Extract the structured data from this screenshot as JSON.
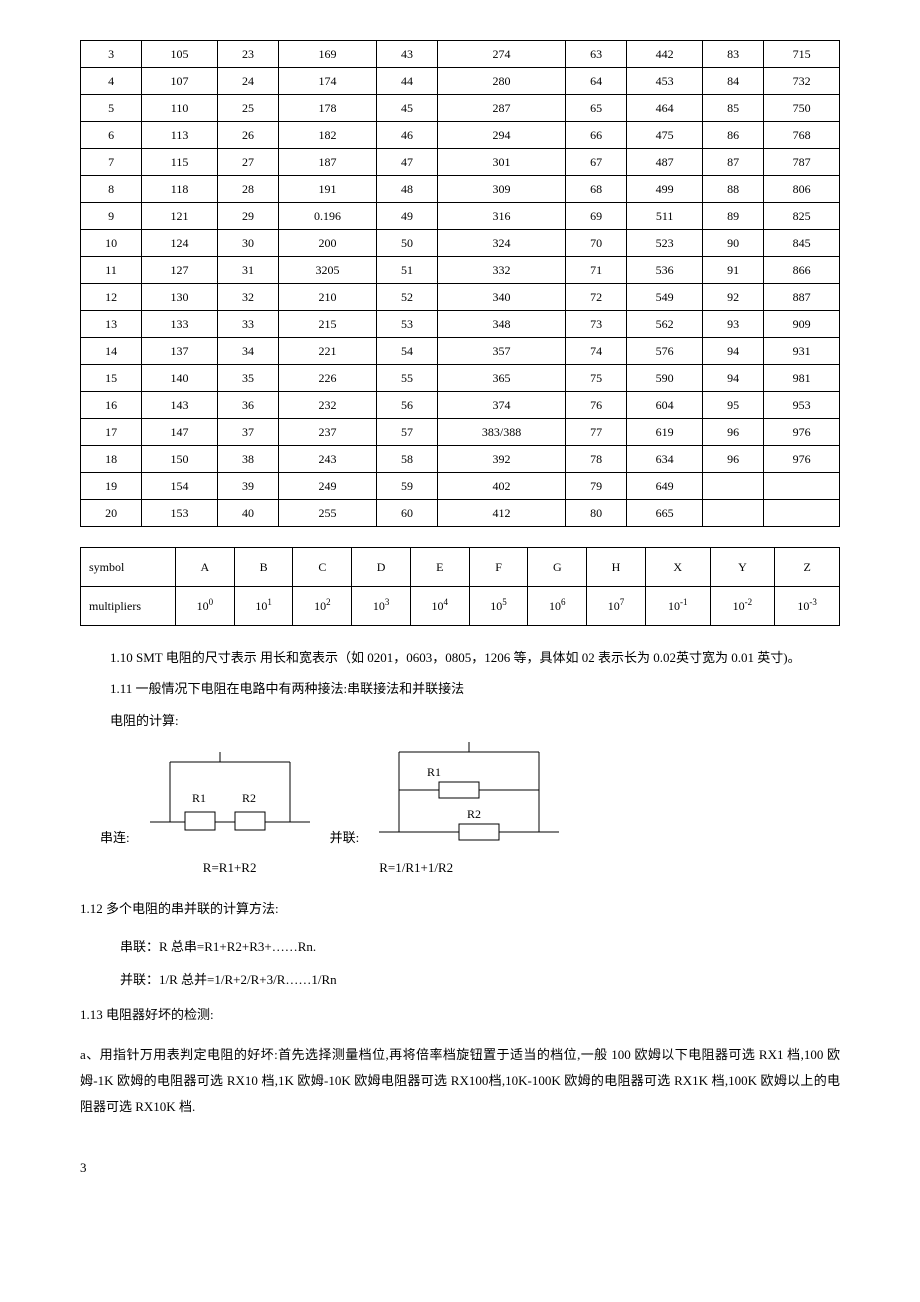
{
  "table1": {
    "rows": [
      [
        "3",
        "105",
        "23",
        "169",
        "43",
        "274",
        "63",
        "442",
        "83",
        "715"
      ],
      [
        "4",
        "107",
        "24",
        "174",
        "44",
        "280",
        "64",
        "453",
        "84",
        "732"
      ],
      [
        "5",
        "110",
        "25",
        "178",
        "45",
        "287",
        "65",
        "464",
        "85",
        "750"
      ],
      [
        "6",
        "113",
        "26",
        "182",
        "46",
        "294",
        "66",
        "475",
        "86",
        "768"
      ],
      [
        "7",
        "115",
        "27",
        "187",
        "47",
        "301",
        "67",
        "487",
        "87",
        "787"
      ],
      [
        "8",
        "118",
        "28",
        "191",
        "48",
        "309",
        "68",
        "499",
        "88",
        "806"
      ],
      [
        "9",
        "121",
        "29",
        "0.196",
        "49",
        "316",
        "69",
        "511",
        "89",
        "825"
      ],
      [
        "10",
        "124",
        "30",
        "200",
        "50",
        "324",
        "70",
        "523",
        "90",
        "845"
      ],
      [
        "11",
        "127",
        "31",
        "3205",
        "51",
        "332",
        "71",
        "536",
        "91",
        "866"
      ],
      [
        "12",
        "130",
        "32",
        "210",
        "52",
        "340",
        "72",
        "549",
        "92",
        "887"
      ],
      [
        "13",
        "133",
        "33",
        "215",
        "53",
        "348",
        "73",
        "562",
        "93",
        "909"
      ],
      [
        "14",
        "137",
        "34",
        "221",
        "54",
        "357",
        "74",
        "576",
        "94",
        "931"
      ],
      [
        "15",
        "140",
        "35",
        "226",
        "55",
        "365",
        "75",
        "590",
        "94",
        "981"
      ],
      [
        "16",
        "143",
        "36",
        "232",
        "56",
        "374",
        "76",
        "604",
        "95",
        "953"
      ],
      [
        "17",
        "147",
        "37",
        "237",
        "57",
        "383/388",
        "77",
        "619",
        "96",
        "976"
      ],
      [
        "18",
        "150",
        "38",
        "243",
        "58",
        "392",
        "78",
        "634",
        "96",
        "976"
      ],
      [
        "19",
        "154",
        "39",
        "249",
        "59",
        "402",
        "79",
        "649",
        "",
        ""
      ],
      [
        "20",
        "153",
        "40",
        "255",
        "60",
        "412",
        "80",
        "665",
        "",
        ""
      ]
    ]
  },
  "table2": {
    "row1_label": "symbol",
    "row1": [
      "A",
      "B",
      "C",
      "D",
      "E",
      "F",
      "G",
      "H",
      "X",
      "Y",
      "Z"
    ],
    "row2_label": "multipliers",
    "row2_base": "10",
    "row2_exp": [
      "0",
      "1",
      "2",
      "3",
      "4",
      "5",
      "6",
      "7",
      "-1",
      "-2",
      "-3"
    ]
  },
  "text": {
    "p110": "1.10  SMT 电阻的尺寸表示 用长和宽表示（如 0201，0603，0805，1206 等，具体如 02 表示长为 0.02英寸宽为 0.01 英寸)。",
    "p111": "1.11 一般情况下电阻在电路中有两种接法:串联接法和并联接法",
    "calc_label": "电阻的计算:",
    "series_label": "串连:",
    "parallel_label": "并联:",
    "series_r": "R=R1+R2",
    "parallel_r": "R=1/R1+1/R2",
    "r1": "R1",
    "r2": "R2",
    "p112": "1.12  多个电阻的串并联的计算方法:",
    "p112a": "串联：R 总串=R1+R2+R3+……Rn.",
    "p112b": "并联：1/R 总并=1/R+2/R+3/R……1/Rn",
    "p113": "1.13  电阻器好坏的检测:",
    "p113a": "a、用指针万用表判定电阻的好坏:首先选择测量档位,再将倍率档旋钮置于适当的档位,一般 100 欧姆以下电阻器可选 RX1 档,100 欧姆-1K 欧姆的电阻器可选 RX10 档,1K 欧姆-10K 欧姆电阻器可选 RX100档,10K-100K 欧姆的电阻器可选 RX1K 档,100K 欧姆以上的电阻器可选 RX10K 档.",
    "page_number": "3"
  }
}
